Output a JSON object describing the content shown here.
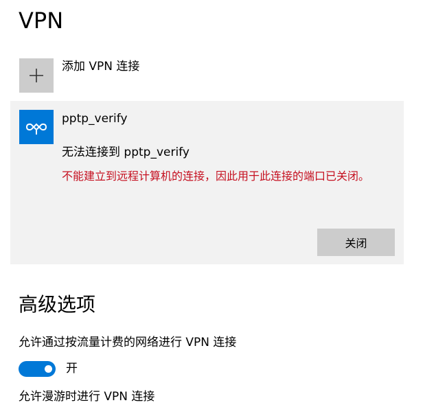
{
  "page": {
    "title": "VPN"
  },
  "add_vpn": {
    "label": "添加 VPN 连接",
    "icon": "plus-icon"
  },
  "vpn_connection": {
    "name": "pptp_verify",
    "icon": "vpn-link-icon",
    "status": "无法连接到 pptp_verify",
    "error": "不能建立到远程计算机的连接，因此用于此连接的端口已关闭。",
    "close_button": "关闭"
  },
  "advanced": {
    "title": "高级选项",
    "metered": {
      "label": "允许通过按流量计费的网络进行 VPN 连接",
      "toggle_on": true,
      "state_label": "开"
    },
    "roaming": {
      "label": "允许漫游时进行 VPN 连接"
    }
  },
  "colors": {
    "accent": "#0078d7",
    "error": "#c50f1f",
    "card_background": "#f2f2f2",
    "button_background": "#cccccc"
  }
}
